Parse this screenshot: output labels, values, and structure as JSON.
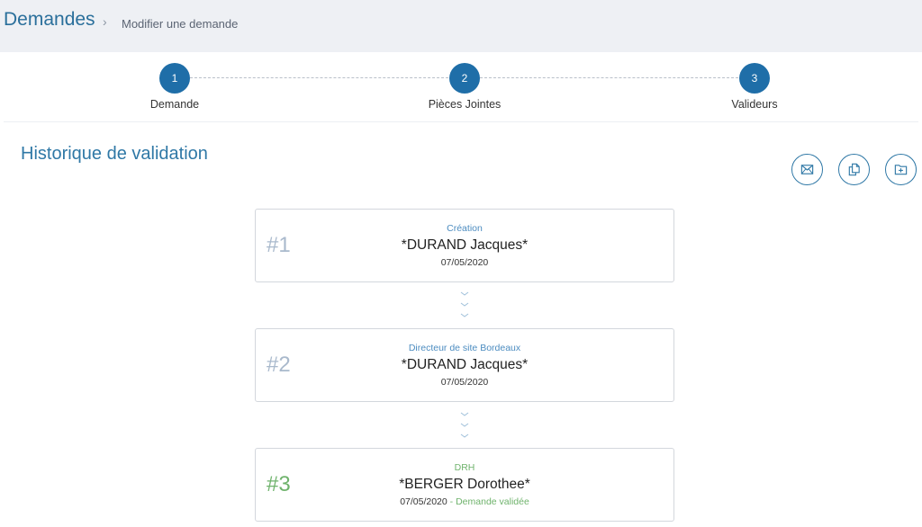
{
  "breadcrumb": {
    "title": "Demandes",
    "separator": "›",
    "current": "Modifier une demande"
  },
  "stepper": {
    "steps": [
      {
        "number": "1",
        "label": "Demande"
      },
      {
        "number": "2",
        "label": "Pièces Jointes"
      },
      {
        "number": "3",
        "label": "Valideurs"
      }
    ]
  },
  "history": {
    "title": "Historique de validation",
    "actions": [
      {
        "icon": "mail-icon"
      },
      {
        "icon": "copy-icon"
      },
      {
        "icon": "folder-add-icon"
      }
    ],
    "entries": [
      {
        "number": "#1",
        "role": "Création",
        "name": "*DURAND Jacques*",
        "date": "07/05/2020",
        "status": ""
      },
      {
        "number": "#2",
        "role": "Directeur de site Bordeaux",
        "name": "*DURAND Jacques*",
        "date": "07/05/2020",
        "status": ""
      },
      {
        "number": "#3",
        "role": "DRH",
        "name": "*BERGER Dorothee*",
        "date": "07/05/2020",
        "status": "Demande validée"
      }
    ]
  },
  "colors": {
    "primary": "#1f6ea8",
    "accent_blue": "#2f78a6",
    "validated_green": "#6fb36c"
  }
}
